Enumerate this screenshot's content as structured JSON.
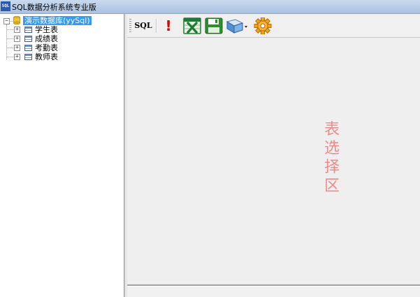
{
  "window": {
    "title": "SQL数据分析系统专业版",
    "icon_label": "SQL"
  },
  "tree": {
    "root": {
      "label": "演示数据库(yySql)",
      "selected": true
    },
    "items": [
      {
        "label": "学生表"
      },
      {
        "label": "成绩表"
      },
      {
        "label": "考勤表"
      },
      {
        "label": "教师表"
      }
    ]
  },
  "toolbar": {
    "sql_label": "SQL",
    "exclaim_label": "!",
    "icons": [
      "sql-icon",
      "execute-exclamation-icon",
      "excel-export-icon",
      "save-disk-icon",
      "open-dropdown-icon",
      "settings-gear-icon"
    ]
  },
  "content": {
    "hint_chars": [
      "表",
      "选",
      "择",
      "区"
    ]
  },
  "colors": {
    "selection": "#3399ff",
    "hint_text": "#f08a8a",
    "excel_green": "#1e7b34",
    "save_green": "#2f8f2f",
    "gear_orange": "#f4a21a"
  }
}
